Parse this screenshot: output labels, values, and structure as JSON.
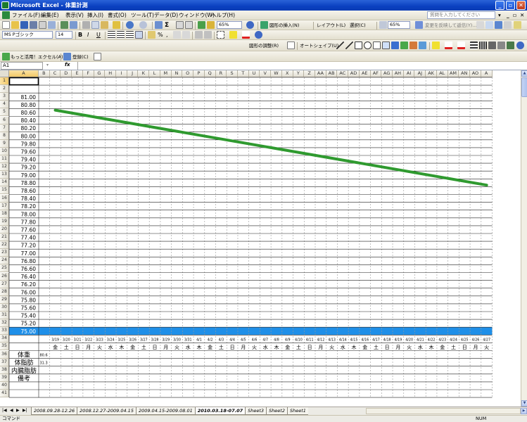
{
  "window": {
    "title": "Microsoft Excel - 体重計測"
  },
  "menu": {
    "items": [
      "ファイル(F)",
      "編集(E)",
      "表示(V)",
      "挿入(I)",
      "書式(O)",
      "ツール(T)",
      "データ(D)",
      "ウィンドウ(W)",
      "ヘルプ(H)"
    ],
    "help_placeholder": "質問を入力してください"
  },
  "toolbar": {
    "zoom": "65%",
    "insert_shape_label": "図形の挿入(N)",
    "layout_label": "レイアウト(L)",
    "select_label": "選択(C)",
    "diagram_zoom": "65%",
    "review_label": "変更を反映して返信(Y)...",
    "font_name": "MS Pゴシック",
    "font_size": "14",
    "bold": "B",
    "italic": "I",
    "underline": "U",
    "percent": "%",
    "comma": ",",
    "draw_adjust_label": "図形の調整(R)",
    "autoshape_label": "オートシェイプ(U)",
    "excel_link_label": "もっと活用！エクセル(A)",
    "register_label": "登録(C)"
  },
  "formula_bar": {
    "cell_ref": "A1",
    "fx": "fx",
    "value": ""
  },
  "grid": {
    "columns": [
      "A",
      "B",
      "C",
      "D",
      "E",
      "F",
      "G",
      "H",
      "I",
      "J",
      "K",
      "L",
      "M",
      "N",
      "O",
      "P",
      "Q",
      "R",
      "S",
      "T",
      "U",
      "V",
      "W",
      "X",
      "Y",
      "Z",
      "AA",
      "AB",
      "AC",
      "AD",
      "AE",
      "AF",
      "AG",
      "AH",
      "AI",
      "AJ",
      "AK",
      "AL",
      "AM",
      "AN",
      "AO",
      "A"
    ],
    "rows": [
      "1",
      "2",
      "3",
      "4",
      "5",
      "6",
      "7",
      "8",
      "9",
      "10",
      "11",
      "12",
      "13",
      "14",
      "15",
      "16",
      "17",
      "18",
      "19",
      "20",
      "21",
      "22",
      "23",
      "24",
      "25",
      "26",
      "27",
      "28",
      "29",
      "30",
      "31",
      "32",
      "33",
      "34",
      "35",
      "36",
      "37",
      "38",
      "39",
      "40",
      "41"
    ],
    "row_labels": {
      "r36": "体重",
      "r37": "体脂肪",
      "r38": "内臓脂肪",
      "r39": "備考",
      "v36": "80.6",
      "v37": "31.3"
    }
  },
  "chart_data": {
    "type": "line",
    "ylim": [
      75.0,
      81.0
    ],
    "y_ticks": [
      "81.00",
      "80.80",
      "80.60",
      "80.40",
      "80.20",
      "80.00",
      "79.80",
      "79.60",
      "79.40",
      "79.20",
      "79.00",
      "78.80",
      "78.60",
      "78.40",
      "78.20",
      "78.00",
      "77.80",
      "77.60",
      "77.40",
      "77.20",
      "77.00",
      "76.80",
      "76.60",
      "76.40",
      "76.20",
      "76.00",
      "75.80",
      "75.60",
      "75.40",
      "75.20",
      "75.00"
    ],
    "x_dates": [
      "3/19",
      "3/20",
      "3/21",
      "3/22",
      "3/23",
      "3/24",
      "3/25",
      "3/26",
      "3/27",
      "3/28",
      "3/29",
      "3/30",
      "3/31",
      "4/1",
      "4/2",
      "4/3",
      "4/4",
      "4/5",
      "4/6",
      "4/7",
      "4/8",
      "4/9",
      "4/10",
      "4/11",
      "4/12",
      "4/13",
      "4/14",
      "4/15",
      "4/16",
      "4/17",
      "4/18",
      "4/19",
      "4/20",
      "4/21",
      "4/22",
      "4/23",
      "4/24",
      "4/25",
      "4/26",
      "4/27"
    ],
    "x_weekdays": [
      "金",
      "土",
      "日",
      "月",
      "火",
      "水",
      "木",
      "金",
      "土",
      "日",
      "月",
      "火",
      "水",
      "木",
      "金",
      "土",
      "日",
      "月",
      "火",
      "水",
      "木",
      "金",
      "土",
      "日",
      "月",
      "火",
      "水",
      "木",
      "金",
      "土",
      "日",
      "月",
      "火",
      "水",
      "木",
      "金",
      "土",
      "日",
      "月",
      "火"
    ],
    "series": [
      {
        "color": "#2f9a2f",
        "x": [
          "3/19",
          "4/27"
        ],
        "y": [
          80.66,
          78.74
        ]
      }
    ]
  },
  "sheet_tabs": [
    "2008.09.28-12.26",
    "2008.12.27-2009.04.15",
    "2009.04.15-2009.08.01",
    "2010.03.18-07.07",
    "Sheet3",
    "Sheet2",
    "Sheet1"
  ],
  "active_tab_index": 3,
  "status": {
    "left": "コマンド",
    "num": "NUM"
  },
  "colors": {
    "header_band": "#1f8fe8",
    "line": "#2f9a2f",
    "title_bar": "#0a46c8"
  }
}
